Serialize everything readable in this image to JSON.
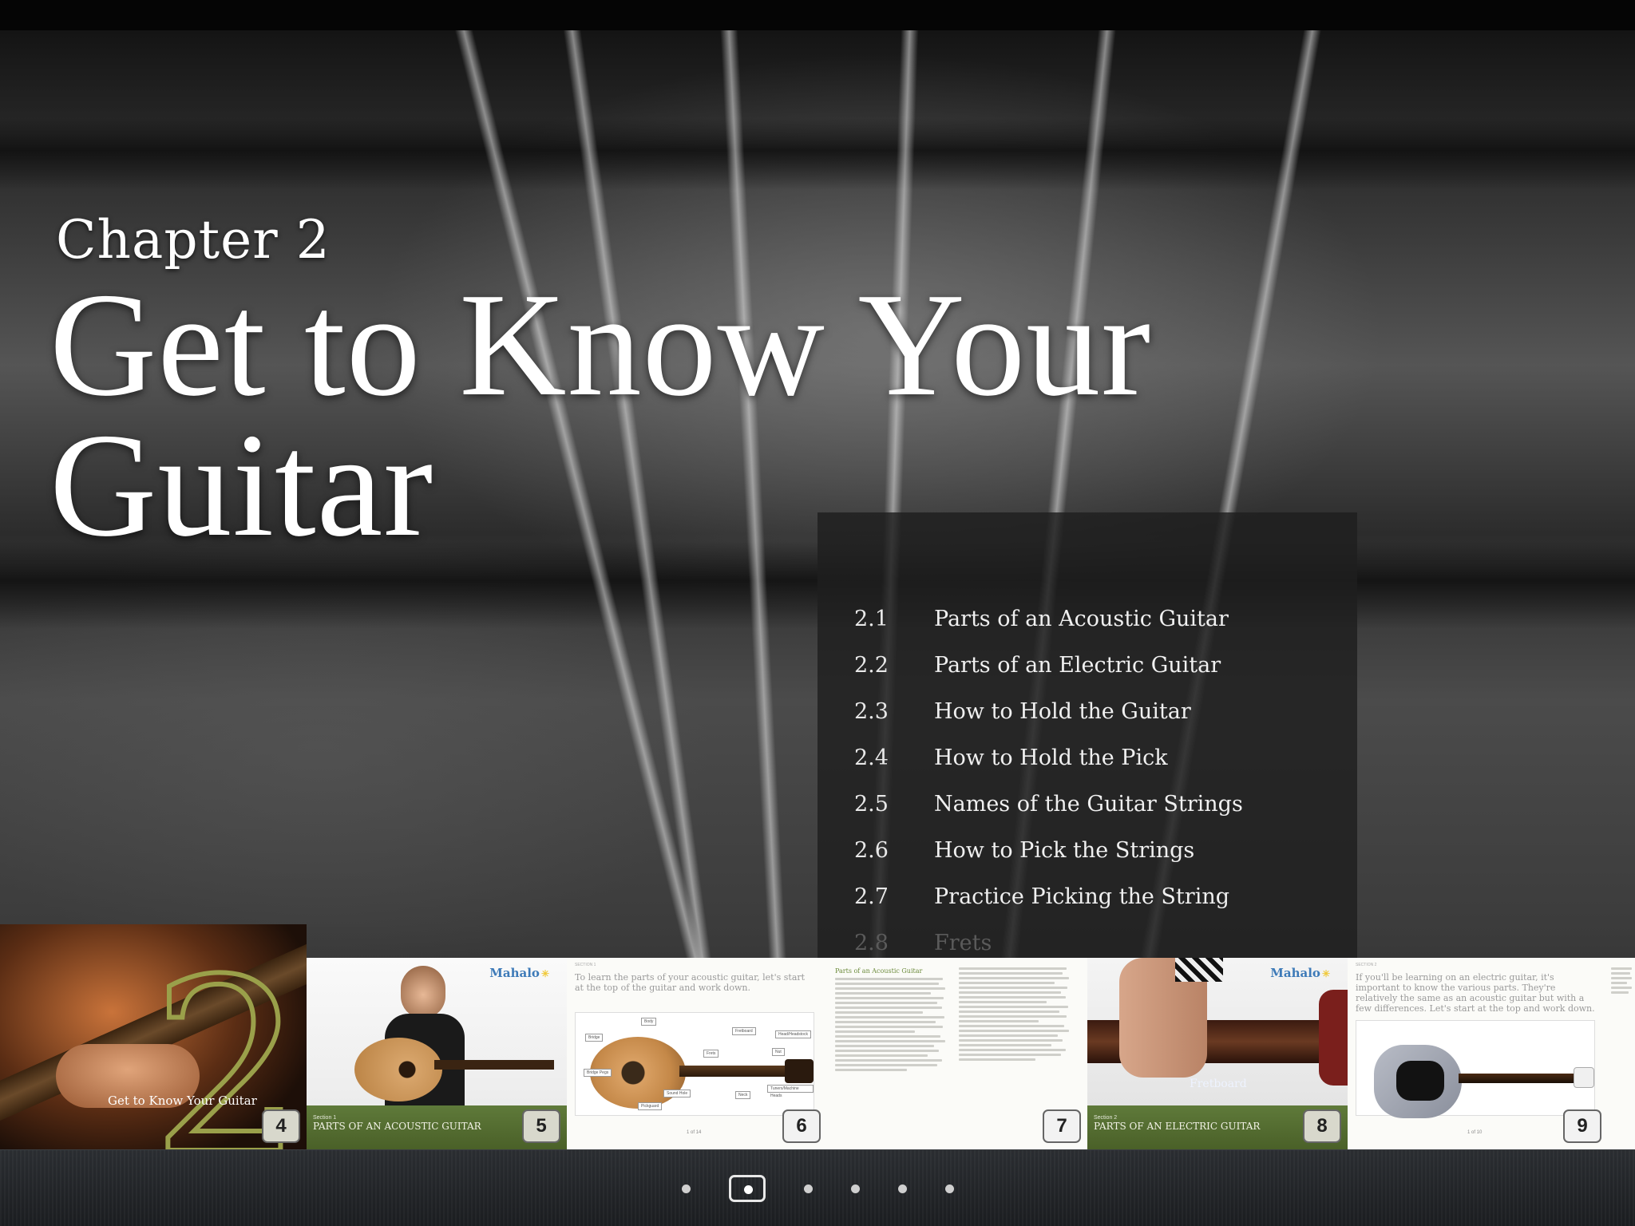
{
  "chapter": {
    "label": "Chapter 2",
    "title_line1": "Get to Know Your",
    "title_line2": "Guitar"
  },
  "toc": [
    {
      "num": "2.1",
      "title": "Parts of an Acoustic Guitar"
    },
    {
      "num": "2.2",
      "title": "Parts of an Electric Guitar"
    },
    {
      "num": "2.3",
      "title": "How to Hold the Guitar"
    },
    {
      "num": "2.4",
      "title": "How to Hold the Pick"
    },
    {
      "num": "2.5",
      "title": "Names of the Guitar Strings"
    },
    {
      "num": "2.6",
      "title": "How to Pick the Strings"
    },
    {
      "num": "2.7",
      "title": "Practice Picking the String"
    },
    {
      "num": "2.8",
      "title": "Frets"
    }
  ],
  "thumbnails": {
    "cover": {
      "caption": "Get to Know Your Guitar",
      "page": "4",
      "digit": "2"
    },
    "acoustic_intro": {
      "brand": "Mahalo",
      "section_small": "Section 1",
      "section_title": "PARTS OF AN ACOUSTIC GUITAR",
      "page": "5"
    },
    "acoustic_diagram": {
      "section_tag": "SECTION 1",
      "lead": "To learn the parts of your acoustic guitar, let's start at the top of the guitar and work down.",
      "footer": "1 of 14",
      "page": "6",
      "labels": [
        "Body",
        "Bridge",
        "Fretboard",
        "Head/Headstock",
        "Frets",
        "Nut",
        "Bridge Pegs",
        "Sound Hole",
        "Neck",
        "Tuners/Machine Heads",
        "Pickguard"
      ]
    },
    "acoustic_text": {
      "heading": "Parts of an Acoustic Guitar",
      "page": "7"
    },
    "electric_intro": {
      "brand": "Mahalo",
      "section_small": "Section 2",
      "section_title": "PARTS OF AN ELECTRIC GUITAR",
      "page": "8",
      "overlay": "Fretboard"
    },
    "electric_diagram": {
      "section_tag": "SECTION 2",
      "lead": "If you'll be learning on an electric guitar, it's important to know the various parts. They're relatively the same as an acoustic guitar but with a few differences. Let's start at the top and work down.",
      "footer": "1 of 10",
      "page": "9"
    }
  },
  "page_dots": {
    "count": 6,
    "current_index": 1
  },
  "colors": {
    "accent_green": "#5f7a3a",
    "brand_blue": "#3d7ab8",
    "cover_outline": "#9aa04a"
  }
}
